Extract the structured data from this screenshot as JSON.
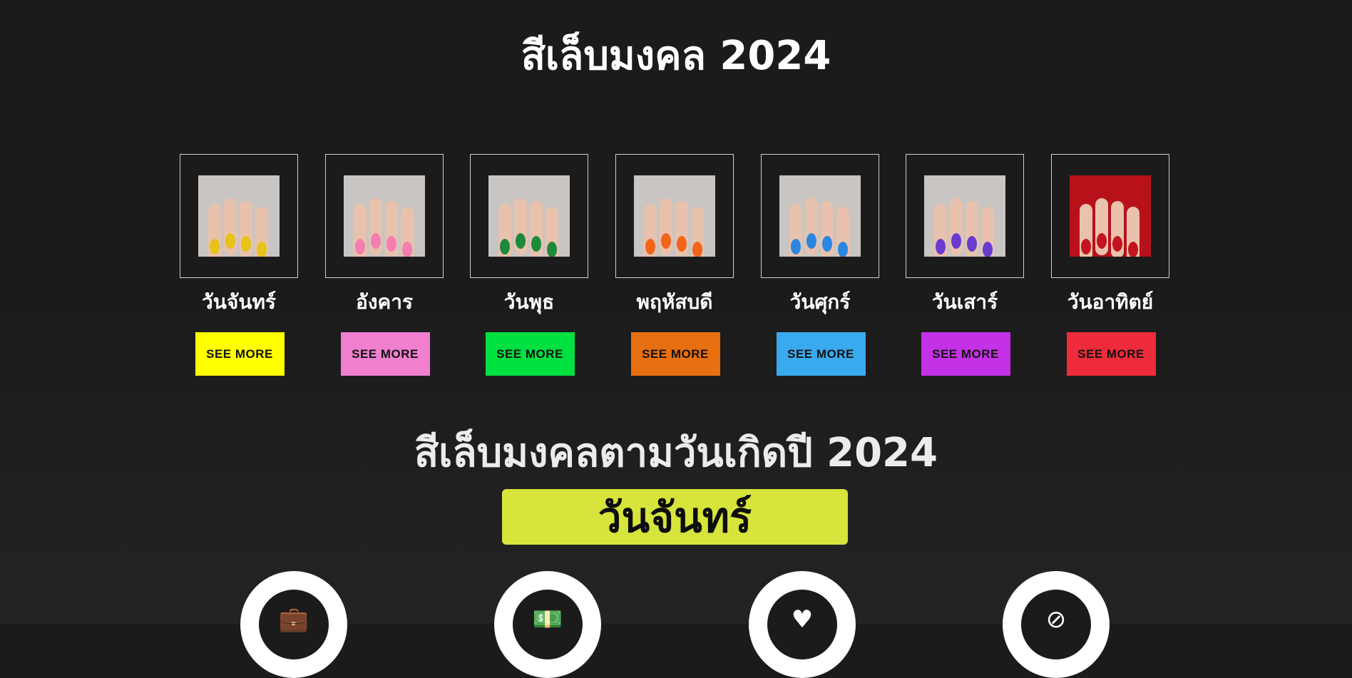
{
  "header": {
    "title": "สีเล็บมงคล 2024"
  },
  "days": [
    {
      "label": "วันจันทร์",
      "button": "SEE MORE",
      "color": "#ffff00",
      "nail_color": "#e6c21a",
      "image": "yellow-nails-photo"
    },
    {
      "label": "อังคาร",
      "button": "SEE MORE",
      "color": "#f07fd0",
      "nail_color": "#f47eb0",
      "image": "pink-nails-photo"
    },
    {
      "label": "วันพุธ",
      "button": "SEE MORE",
      "color": "#00e040",
      "nail_color": "#1c8a3a",
      "image": "green-nails-photo"
    },
    {
      "label": "พฤหัสบดี",
      "button": "SEE MORE",
      "color": "#e86f10",
      "nail_color": "#f0651c",
      "image": "orange-nails-photo"
    },
    {
      "label": "วันศุกร์",
      "button": "SEE MORE",
      "color": "#3aaaee",
      "nail_color": "#2a86e0",
      "image": "blue-nails-photo"
    },
    {
      "label": "วันเสาร์",
      "button": "SEE MORE",
      "color": "#c431e6",
      "nail_color": "#6a3bd0",
      "image": "purple-nails-photo"
    },
    {
      "label": "วันอาทิตย์",
      "button": "SEE MORE",
      "color": "#ee2b3a",
      "nail_color": "#c4141e",
      "image": "red-nails-photo"
    }
  ],
  "section": {
    "title": "สีเล็บมงคลตามวันเกิดปี 2024",
    "selected_day": "วันจันทร์",
    "selected_color": "#d6e43c"
  },
  "categories": [
    {
      "icon": "briefcase-icon",
      "glyph": "💼"
    },
    {
      "icon": "money-icon",
      "glyph": "💵"
    },
    {
      "icon": "heart-icon",
      "glyph": "♥"
    },
    {
      "icon": "health-icon",
      "glyph": "⊘"
    }
  ]
}
